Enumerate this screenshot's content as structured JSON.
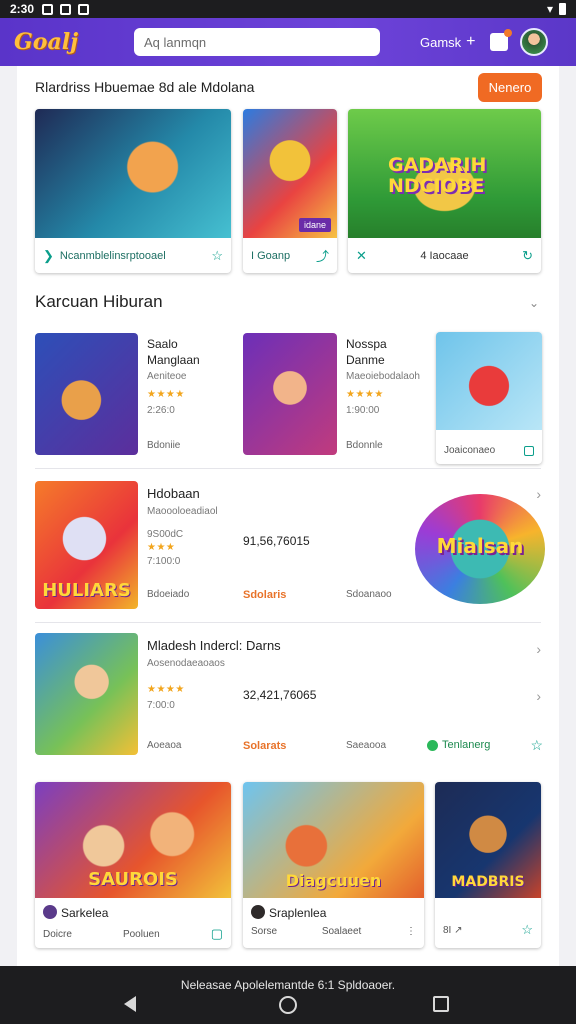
{
  "status": {
    "time": "2:30"
  },
  "app": {
    "logo": "Goalj",
    "search_placeholder": "Aq lanmqn",
    "action_label": "Gamsk",
    "action_plus": "+"
  },
  "featured": {
    "header": "Rlardriss Hbuemae 8d ale Mdolana",
    "more_label": "Nenero",
    "cards": [
      {
        "label": "Ncanmblelinsrptooael",
        "lead_icon": "chevron-right-icon",
        "trail_icon": "star-outline-icon"
      },
      {
        "label": "I Goanp",
        "badge": "idane",
        "lead_icon": "",
        "trail_icon": "share-icon"
      },
      {
        "label": "4 Iaocaae",
        "title": "GADARIH NDCIOBE",
        "lead_icon": "close-icon",
        "trail_icon": "refresh-icon"
      }
    ]
  },
  "section": {
    "title": "Karcuan Hiburan",
    "chevron": "⌄",
    "row1": [
      {
        "title_line1": "Saalo",
        "title_line2": "Manglaan",
        "sub": "Aeniteoe",
        "stars": "★★★★",
        "count": "2:26:0",
        "meta": "Bdoniie"
      },
      {
        "title_line1": "Nosspa",
        "title_line2": "Danme",
        "sub": "Maeoiebodalaoh",
        "stars": "★★★★",
        "count": "1:90:00",
        "meta": "Bdonnle"
      },
      {
        "meta": "Joaiconaeo"
      }
    ],
    "row2": {
      "title": "Hdobaan",
      "sub": "Maoooloeadiaol",
      "s1": "9S00dC",
      "stars": "★★★",
      "s2": "7:100:0",
      "price": "91,56,76015",
      "m1": "Bdoeiado",
      "m2": "Sdolaris",
      "m3": "Sdoanaoo",
      "logo_text": "Mialsan"
    },
    "row3": {
      "title": "Mladesh Indercl: Darns",
      "sub": "Aosenodaeaoaos",
      "stars": "★★★★",
      "s2": "7:00:0",
      "price": "32,421,76065",
      "m1": "Aoeaoa",
      "m2": "Solarats",
      "m3": "Saeaooa",
      "m4": "Tenlanerg"
    }
  },
  "bottom_cards": [
    {
      "art_title": "SAUROIS",
      "name": "Sarkelea",
      "foot_left": "Doicre",
      "foot_mid": "Pooluen"
    },
    {
      "art_title": "Diagcuuen",
      "name": "Sraplenlea",
      "foot_left": "Sorse",
      "foot_mid": "Soalaeet"
    },
    {
      "art_title": "MADBRIS",
      "name": "",
      "foot_left": "8I ↗"
    }
  ],
  "footer": {
    "toast": "Neleasae Apolelemantde 6:1 Spldoaoer."
  }
}
